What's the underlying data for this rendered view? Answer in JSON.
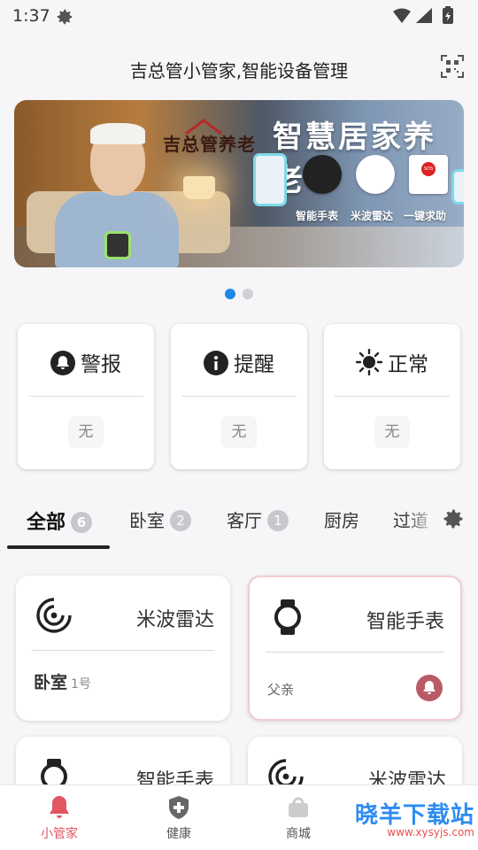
{
  "status_bar": {
    "time": "1:37"
  },
  "header": {
    "title": "吉总管小管家,智能设备管理"
  },
  "banner": {
    "brand": "吉总管养老",
    "headline": "智慧居家养老",
    "devices": [
      "智能手表",
      "米波雷达",
      "一键求助"
    ],
    "sos": "SOS"
  },
  "carousel": {
    "pages": 2,
    "active": 0
  },
  "status_cards": [
    {
      "label": "警报",
      "icon": "bell-icon",
      "value": "无"
    },
    {
      "label": "提醒",
      "icon": "info-icon",
      "value": "无"
    },
    {
      "label": "正常",
      "icon": "sun-icon",
      "value": "无"
    }
  ],
  "tabs": [
    {
      "label": "全部",
      "count": "6"
    },
    {
      "label": "卧室",
      "count": "2"
    },
    {
      "label": "客厅",
      "count": "1"
    },
    {
      "label": "厨房",
      "count": ""
    },
    {
      "label": "过道",
      "count": ""
    }
  ],
  "devices": [
    {
      "type": "米波雷达",
      "icon": "radar-icon",
      "room": "卧室",
      "room_no": "1号",
      "alert": false
    },
    {
      "type": "智能手表",
      "icon": "watch-icon",
      "owner": "父亲",
      "alert": true
    },
    {
      "type": "智能手表",
      "icon": "watch-icon"
    },
    {
      "type": "米波雷达",
      "icon": "radar-icon"
    }
  ],
  "bottom_nav": [
    {
      "label": "小管家",
      "icon": "bell-icon",
      "active": true
    },
    {
      "label": "健康",
      "icon": "shield-plus-icon",
      "active": false
    },
    {
      "label": "商城",
      "icon": "shop-icon",
      "active": false
    }
  ],
  "watermark": {
    "text": "晓羊下载站",
    "url": "www.xysyjs.com"
  },
  "colors": {
    "accent": "#e25563",
    "active_dot": "#1e88e5",
    "background": "#f6f6f8"
  }
}
